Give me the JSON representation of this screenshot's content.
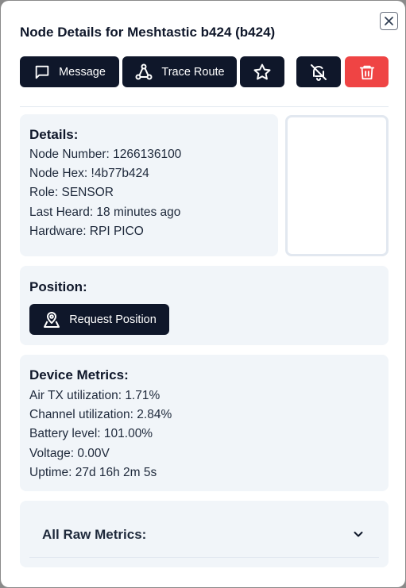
{
  "dialog": {
    "title": "Node Details for Meshtastic b424 (b424)",
    "close_icon": "close-icon"
  },
  "actions": {
    "message_label": "Message",
    "message_icon": "message-square-icon",
    "trace_label": "Trace Route",
    "trace_icon": "route-icon",
    "favorite_icon": "star-icon",
    "mute_icon": "bell-off-icon",
    "delete_icon": "trash-icon"
  },
  "details": {
    "title": "Details:",
    "lines": [
      "Node Number: 1266136100",
      "Node Hex: !4b77b424",
      "Role: SENSOR",
      "Last Heard: 18 minutes ago",
      "Hardware: RPI PICO"
    ]
  },
  "position": {
    "title": "Position:",
    "request_label": "Request Position",
    "request_icon": "map-pin-icon"
  },
  "metrics": {
    "title": "Device Metrics:",
    "lines": [
      "Air TX utilization: 1.71%",
      "Channel utilization: 2.84%",
      "Battery level: 101.00%",
      "Voltage: 0.00V",
      "Uptime: 27d 16h 2m 5s"
    ]
  },
  "raw_metrics": {
    "title": "All Raw Metrics:",
    "chevron_icon": "chevron-down-icon"
  },
  "colors": {
    "primary": "#0f172a",
    "danger": "#ef4444",
    "card": "#f1f5f9"
  }
}
